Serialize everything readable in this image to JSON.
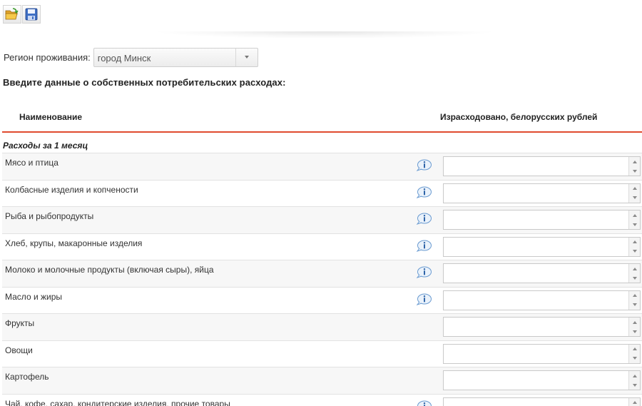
{
  "toolbar": {
    "open_icon": "open-folder-icon",
    "save_icon": "floppy-save-icon"
  },
  "region": {
    "label": "Регион проживания:",
    "selected": "город Минск"
  },
  "section_title": "Введите данные о собственных потребительских расходах:",
  "table": {
    "col_name": "Наименование",
    "col_spent": "Израсходовано, белорусских рублей",
    "accent_color": "#e04b2e",
    "group_title": "Расходы за 1 месяц",
    "rows": [
      {
        "label": "Мясо и птица",
        "info": true,
        "value": ""
      },
      {
        "label": "Колбасные изделия и копчености",
        "info": true,
        "value": ""
      },
      {
        "label": "Рыба и рыбопродукты",
        "info": true,
        "value": ""
      },
      {
        "label": "Хлеб, крупы, макаронные изделия",
        "info": true,
        "value": ""
      },
      {
        "label": "Молоко и молочные продукты (включая сыры), яйца",
        "info": true,
        "value": ""
      },
      {
        "label": "Масло и жиры",
        "info": true,
        "value": ""
      },
      {
        "label": "Фрукты",
        "info": false,
        "value": ""
      },
      {
        "label": "Овощи",
        "info": false,
        "value": ""
      },
      {
        "label": "Картофель",
        "info": false,
        "value": ""
      },
      {
        "label": "Чай, кофе, сахар, кондитерские изделия, прочие товары",
        "info": true,
        "value": ""
      }
    ]
  }
}
